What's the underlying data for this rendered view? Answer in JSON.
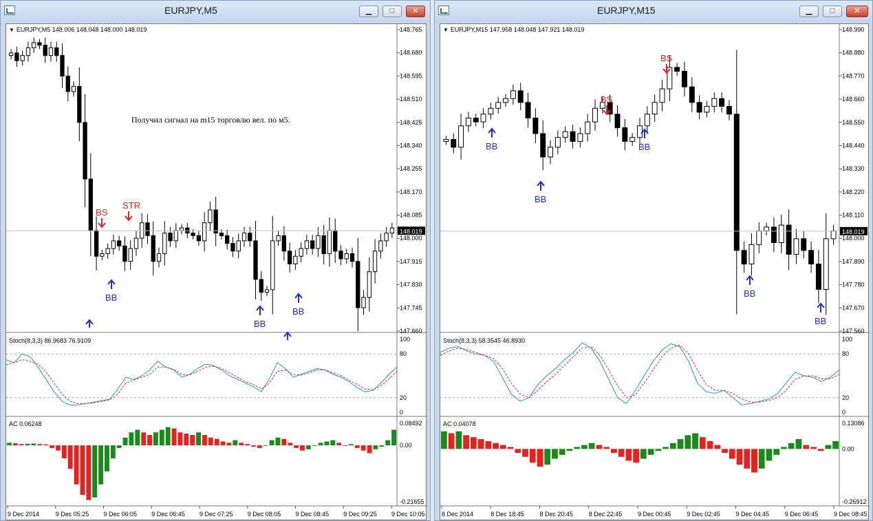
{
  "windows": [
    {
      "title": "EURJPY,M5",
      "symbol_info": "EURJPY,M5  148.006 148.048 148.000 148.019",
      "price_axis": [
        "148.765",
        "148.680",
        "148.595",
        "148.510",
        "148.425",
        "148.340",
        "148.255",
        "148.170",
        "148.085",
        "148.000",
        "147.915",
        "147.830",
        "147.745",
        "147.660"
      ],
      "current_price": "148.019",
      "note": "Получил сигнал на m15 торговлю вел. по м5.",
      "stoch_label": "Stoch(8,3,3) 86.9683 76.9109",
      "stoch_axis": [
        "100",
        "80",
        "20",
        "0"
      ],
      "ac_label": "AC 0.06248",
      "ac_axis": [
        "0.08492",
        "0.00",
        "-0.21655"
      ],
      "time_axis": [
        "9 Dec 2014",
        "9 Dec 05:25",
        "9 Dec 06:05",
        "9 Dec 06:45",
        "9 Dec 07:25",
        "9 Dec 08:05",
        "9 Dec 08:45",
        "9 Dec 09:25",
        "9 Dec 10:05"
      ],
      "markers": [
        {
          "text": "BS",
          "color": "#e8201e"
        },
        {
          "text": "STR",
          "color": "#e8201e"
        },
        {
          "text": "BB",
          "color": "#1e2fd0"
        },
        {
          "text": "BB",
          "color": "#1e2fd0"
        },
        {
          "text": "BB",
          "color": "#1e2fd0"
        }
      ],
      "chart_data": {
        "type": "candlestick",
        "close": [
          148.71,
          148.68,
          148.7,
          148.73,
          148.75,
          148.74,
          148.7,
          148.73,
          148.7,
          148.62,
          148.56,
          148.58,
          148.44,
          148.22,
          148.02,
          147.92,
          147.93,
          147.95,
          147.98,
          147.96,
          147.9,
          147.95,
          147.99,
          148.05,
          148.0,
          147.9,
          147.93,
          148.01,
          147.98,
          148.02,
          148.03,
          148.01,
          148.0,
          147.98,
          148.05,
          148.1,
          148.01,
          148.0,
          147.97,
          147.94,
          147.98,
          148.01,
          147.98,
          147.83,
          147.78,
          147.79,
          147.98,
          148.0,
          147.94,
          147.89,
          147.92,
          147.95,
          147.98,
          147.95,
          148.0,
          147.93,
          148.02,
          147.94,
          147.91,
          147.93,
          147.9,
          147.72,
          147.76,
          147.86,
          147.94,
          147.98,
          148.01,
          148.03
        ],
        "ylim": [
          147.64,
          148.79
        ],
        "stochastic": {
          "main": [
            72,
            68,
            80,
            76,
            62,
            45,
            28,
            15,
            10,
            10,
            12,
            14,
            16,
            18,
            32,
            48,
            45,
            50,
            58,
            70,
            62,
            58,
            48,
            52,
            60,
            66,
            64,
            58,
            50,
            45,
            40,
            35,
            28,
            46,
            68,
            60,
            48,
            52,
            56,
            60,
            58,
            52,
            48,
            42,
            34,
            28,
            30,
            40,
            52,
            62
          ],
          "signal": [
            65,
            68,
            72,
            70,
            66,
            55,
            40,
            25,
            15,
            12,
            12,
            13,
            15,
            17,
            25,
            40,
            44,
            48,
            52,
            62,
            62,
            59,
            52,
            51,
            56,
            62,
            63,
            60,
            54,
            48,
            42,
            38,
            32,
            40,
            56,
            58,
            52,
            51,
            54,
            58,
            58,
            54,
            50,
            44,
            38,
            32,
            31,
            36,
            46,
            56
          ]
        },
        "ac": [
          0.01,
          0.008,
          0.005,
          0.006,
          0.007,
          0.005,
          0.004,
          -0.01,
          -0.02,
          -0.05,
          -0.09,
          -0.15,
          -0.19,
          -0.21,
          -0.2,
          -0.15,
          -0.1,
          -0.05,
          -0.01,
          0.03,
          0.05,
          0.06,
          0.05,
          0.04,
          0.05,
          0.06,
          0.07,
          0.065,
          0.05,
          0.045,
          0.04,
          0.05,
          0.04,
          0.03,
          0.025,
          0.015,
          0.01,
          0.02,
          0.01,
          0.005,
          -0.005,
          -0.01,
          0.0,
          0.02,
          0.03,
          0.025,
          0.01,
          -0.01,
          -0.02,
          -0.015,
          0.0,
          0.01,
          0.015,
          0.02,
          0.01,
          0.0,
          0.005,
          -0.01,
          -0.02,
          -0.03,
          -0.015,
          -0.005,
          0.02,
          0.06
        ]
      }
    },
    {
      "title": "EURJPY,M15",
      "symbol_info": "EURJPY,M15  147.958 148.048 147.921 148.019",
      "price_axis": [
        "148.990",
        "148.880",
        "148.770",
        "148.660",
        "148.550",
        "148.440",
        "148.330",
        "148.220",
        "148.110",
        "148.000",
        "147.890",
        "147.780",
        "147.670",
        "147.560"
      ],
      "current_price": "148.019",
      "stoch_label": "Stoch(8,3,3) 58.3545 46.8930",
      "stoch_axis": [
        "100",
        "80",
        "20",
        "0"
      ],
      "ac_label": "AC 0.04078",
      "ac_axis": [
        "0.13086",
        "0.00",
        "-0.26912"
      ],
      "time_axis": [
        "8 Dec 2014",
        "8 Dec 18:45",
        "8 Dec 20:45",
        "8 Dec 22:45",
        "9 Dec 00:45",
        "9 Dec 02:45",
        "9 Dec 04:45",
        "9 Dec 06:45",
        "9 Dec 08:45"
      ],
      "markers": [
        {
          "text": "BS",
          "color": "#e8201e"
        },
        {
          "text": "BS",
          "color": "#e8201e"
        },
        {
          "text": "BB",
          "color": "#1e2fd0"
        },
        {
          "text": "BB",
          "color": "#1e2fd0"
        },
        {
          "text": "BB",
          "color": "#1e2fd0"
        },
        {
          "text": "BB",
          "color": "#1e2fd0"
        },
        {
          "text": "BB",
          "color": "#1e2fd0"
        }
      ],
      "chart_data": {
        "type": "candlestick",
        "close": [
          148.49,
          148.45,
          148.56,
          148.6,
          148.58,
          148.62,
          148.65,
          148.68,
          148.7,
          148.74,
          148.68,
          148.6,
          148.52,
          148.4,
          148.45,
          148.5,
          148.53,
          148.48,
          148.52,
          148.58,
          148.65,
          148.68,
          148.62,
          148.55,
          148.48,
          148.5,
          148.56,
          148.62,
          148.68,
          148.75,
          148.86,
          148.84,
          148.76,
          148.68,
          148.63,
          148.66,
          148.7,
          148.66,
          148.62,
          147.92,
          147.85,
          147.95,
          148.02,
          148.04,
          147.96,
          148.05,
          147.9,
          147.98,
          147.92,
          147.85,
          147.72,
          147.98,
          148.02
        ],
        "ylim": [
          147.52,
          149.04
        ],
        "stochastic": {
          "main": [
            82,
            88,
            90,
            84,
            80,
            78,
            70,
            48,
            25,
            15,
            20,
            38,
            50,
            60,
            72,
            82,
            95,
            88,
            70,
            45,
            20,
            12,
            30,
            50,
            70,
            85,
            94,
            90,
            70,
            40,
            28,
            26,
            30,
            20,
            10,
            12,
            15,
            18,
            25,
            40,
            55,
            50,
            48,
            42,
            48,
            58
          ],
          "signal": [
            78,
            84,
            88,
            86,
            82,
            78,
            74,
            60,
            40,
            25,
            20,
            30,
            42,
            52,
            64,
            76,
            88,
            90,
            78,
            58,
            36,
            20,
            24,
            40,
            58,
            76,
            88,
            92,
            80,
            58,
            38,
            30,
            30,
            26,
            18,
            14,
            14,
            16,
            20,
            30,
            45,
            50,
            50,
            46,
            46,
            52
          ]
        },
        "ac": [
          0.09,
          0.08,
          0.09,
          0.07,
          0.06,
          0.05,
          0.04,
          0.03,
          0.02,
          0.01,
          -0.02,
          -0.04,
          -0.07,
          -0.09,
          -0.08,
          -0.05,
          -0.03,
          -0.01,
          0.01,
          0.02,
          0.03,
          0.02,
          0.01,
          -0.02,
          -0.04,
          -0.06,
          -0.07,
          -0.05,
          -0.03,
          -0.01,
          0.01,
          0.03,
          0.05,
          0.07,
          0.08,
          0.06,
          0.04,
          0.02,
          -0.02,
          -0.05,
          -0.08,
          -0.1,
          -0.12,
          -0.1,
          -0.06,
          -0.03,
          0.01,
          0.03,
          0.05,
          0.02,
          0.01,
          -0.01,
          0.02,
          0.04
        ]
      }
    }
  ],
  "colors": {
    "up_body": "#ffffff",
    "down_body": "#000000",
    "stoch_main": "#1f9fa7",
    "stoch_signal": "#e8201e",
    "ac_up": "#1a8a1a",
    "ac_down": "#e8201e",
    "grid_level": "#aaaaaa"
  }
}
